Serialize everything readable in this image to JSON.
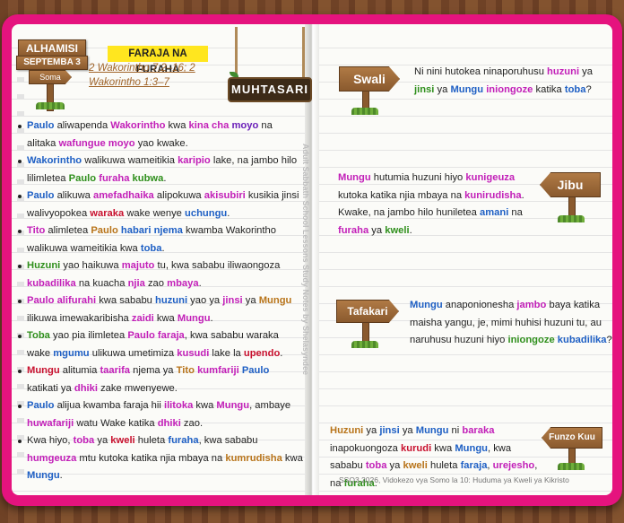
{
  "header": {
    "day": "ALHAMISI",
    "date": "SEPTEMBA 3",
    "soma": "Soma",
    "title": "FARAJA NA FURAHA",
    "ref1": "2 Wakorintho 7:2–16; 2",
    "ref2": "Wakorintho 1:3–7",
    "summary_sign": "MUHTASARI"
  },
  "bullets": [
    [
      [
        "b",
        "Paulo"
      ],
      [
        "n",
        " aliwapenda "
      ],
      [
        "m",
        "Wakorintho"
      ],
      [
        "n",
        " kwa "
      ],
      [
        "m",
        "kina cha"
      ],
      [
        "n",
        " "
      ],
      [
        "p",
        "moyo"
      ],
      [
        "n",
        " na alitaka "
      ],
      [
        "m",
        "wafungue moyo"
      ],
      [
        "n",
        " yao kwake."
      ]
    ],
    [
      [
        "b",
        "Wakorintho"
      ],
      [
        "n",
        " walikuwa wameitikia "
      ],
      [
        "m",
        "karipio"
      ],
      [
        "n",
        " lake, na jambo hilo lilimletea "
      ],
      [
        "g",
        "Paulo"
      ],
      [
        "n",
        " "
      ],
      [
        "m",
        "furaha"
      ],
      [
        "n",
        " "
      ],
      [
        "g",
        "kubwa"
      ],
      [
        "n",
        "."
      ]
    ],
    [
      [
        "b",
        "Paulo"
      ],
      [
        "n",
        " alikuwa "
      ],
      [
        "m",
        "amefadhaika"
      ],
      [
        "n",
        " alipokuwa "
      ],
      [
        "m",
        "akisubiri"
      ],
      [
        "n",
        " kusikia jinsi walivyopokea "
      ],
      [
        "r",
        "waraka"
      ],
      [
        "n",
        " wake wenye "
      ],
      [
        "b",
        "uchungu"
      ],
      [
        "n",
        "."
      ]
    ],
    [
      [
        "m",
        "Tito"
      ],
      [
        "n",
        " alimletea "
      ],
      [
        "o",
        "Paulo"
      ],
      [
        "n",
        " "
      ],
      [
        "b",
        "habari njema"
      ],
      [
        "n",
        " kwamba Wakorintho walikuwa wameitikia kwa "
      ],
      [
        "b",
        "toba"
      ],
      [
        "n",
        "."
      ]
    ],
    [
      [
        "g",
        "Huzuni"
      ],
      [
        "n",
        " yao haikuwa "
      ],
      [
        "m",
        "majuto"
      ],
      [
        "n",
        " tu, kwa sababu iliwaongoza "
      ],
      [
        "m",
        "kubadilika"
      ],
      [
        "n",
        " na kuacha "
      ],
      [
        "m",
        "njia"
      ],
      [
        "n",
        " zao "
      ],
      [
        "m",
        "mbaya"
      ],
      [
        "n",
        "."
      ]
    ],
    [
      [
        "m",
        "Paulo"
      ],
      [
        "n",
        " "
      ],
      [
        "m",
        "alifurahi"
      ],
      [
        "n",
        " kwa sababu "
      ],
      [
        "b",
        "huzuni"
      ],
      [
        "n",
        " yao ya "
      ],
      [
        "m",
        "jinsi"
      ],
      [
        "n",
        " ya "
      ],
      [
        "o",
        "Mungu"
      ],
      [
        "n",
        " ilikuwa imewakaribisha "
      ],
      [
        "m",
        "zaidi"
      ],
      [
        "n",
        " kwa "
      ],
      [
        "m",
        "Mungu"
      ],
      [
        "n",
        "."
      ]
    ],
    [
      [
        "g",
        "Toba"
      ],
      [
        "n",
        " yao pia ilimletea "
      ],
      [
        "m",
        "Paulo"
      ],
      [
        "n",
        " "
      ],
      [
        "m",
        "faraja"
      ],
      [
        "n",
        ", kwa sababu waraka wake "
      ],
      [
        "b",
        "mgumu"
      ],
      [
        "n",
        " ulikuwa umetimiza "
      ],
      [
        "m",
        "kusudi"
      ],
      [
        "n",
        " lake la "
      ],
      [
        "r",
        "upendo"
      ],
      [
        "n",
        "."
      ]
    ],
    [
      [
        "r",
        "Mungu"
      ],
      [
        "n",
        " alitumia "
      ],
      [
        "m",
        "taarifa"
      ],
      [
        "n",
        " njema ya "
      ],
      [
        "o",
        "Tito"
      ],
      [
        "n",
        " "
      ],
      [
        "m",
        "kumfariji"
      ],
      [
        "n",
        " "
      ],
      [
        "b",
        "Paulo"
      ],
      [
        "n",
        " katikati ya "
      ],
      [
        "m",
        "dhiki"
      ],
      [
        "n",
        " zake mwenyewe."
      ]
    ],
    [
      [
        "b",
        "Paulo"
      ],
      [
        "n",
        " alijua kwamba faraja hii "
      ],
      [
        "m",
        "ilitoka"
      ],
      [
        "n",
        " kwa "
      ],
      [
        "m",
        "Mungu"
      ],
      [
        "n",
        ", ambaye "
      ],
      [
        "m",
        "huwafariji"
      ],
      [
        "n",
        " watu Wake katika "
      ],
      [
        "m",
        "dhiki"
      ],
      [
        "n",
        " zao."
      ]
    ],
    [
      [
        "n",
        "Kwa hiyo, "
      ],
      [
        "m",
        "toba"
      ],
      [
        "n",
        " ya "
      ],
      [
        "r",
        "kweli"
      ],
      [
        "n",
        " huleta "
      ],
      [
        "b",
        "furaha"
      ],
      [
        "n",
        ", kwa sababu "
      ],
      [
        "m",
        "humgeuza"
      ],
      [
        "n",
        " mtu kutoka katika njia mbaya na "
      ],
      [
        "o",
        "kumrudisha"
      ],
      [
        "n",
        " kwa "
      ],
      [
        "b",
        "Mungu"
      ],
      [
        "n",
        "."
      ]
    ]
  ],
  "side_text": "Adult Sabbath School Lessons Study Notes by Shelasyndee",
  "signs": {
    "swali": "Swali",
    "jibu": "Jibu",
    "tafakari": "Tafakari",
    "funzo": "Funzo Kuu"
  },
  "right": {
    "swali": [
      [
        "n",
        "Ni nini hutokea ninaporuhusu "
      ],
      [
        "m",
        "huzuni"
      ],
      [
        "n",
        " ya "
      ],
      [
        "g",
        "jinsi"
      ],
      [
        "n",
        " ya "
      ],
      [
        "b",
        "Mungu"
      ],
      [
        "n",
        " "
      ],
      [
        "m",
        "iniongoze"
      ],
      [
        "n",
        " katika "
      ],
      [
        "b",
        "toba"
      ],
      [
        "n",
        "?"
      ]
    ],
    "jibu": [
      [
        "m",
        "Mungu"
      ],
      [
        "n",
        " hutumia huzuni hiyo "
      ],
      [
        "m",
        "kunigeuza"
      ],
      [
        "n",
        " kutoka katika njia mbaya na "
      ],
      [
        "m",
        "kunirudisha"
      ],
      [
        "n",
        ". Kwake, na jambo hilo huniletea "
      ],
      [
        "b",
        "amani"
      ],
      [
        "n",
        " na "
      ],
      [
        "m",
        "furaha"
      ],
      [
        "n",
        " ya "
      ],
      [
        "g",
        "kweli"
      ],
      [
        "n",
        "."
      ]
    ],
    "tafakari": [
      [
        "b",
        "Mungu"
      ],
      [
        "n",
        " anaponionesha "
      ],
      [
        "m",
        "jambo"
      ],
      [
        "n",
        " baya katika maisha yangu, je, mimi huhisi huzuni tu, au naruhusu huzuni hiyo "
      ],
      [
        "g",
        "iniongoze"
      ],
      [
        "n",
        " "
      ],
      [
        "b",
        "kubadilika"
      ],
      [
        "n",
        "?"
      ]
    ],
    "funzo": [
      [
        "o",
        "Huzuni"
      ],
      [
        "n",
        " ya "
      ],
      [
        "b",
        "jinsi"
      ],
      [
        "n",
        " ya "
      ],
      [
        "b",
        "Mungu"
      ],
      [
        "n",
        " ni "
      ],
      [
        "m",
        "baraka"
      ],
      [
        "n",
        " inapokuongoza "
      ],
      [
        "r",
        "kurudi"
      ],
      [
        "n",
        " kwa "
      ],
      [
        "b",
        "Mungu"
      ],
      [
        "n",
        ", kwa sababu "
      ],
      [
        "m",
        "toba"
      ],
      [
        "n",
        " ya "
      ],
      [
        "o",
        "kweli"
      ],
      [
        "n",
        " huleta "
      ],
      [
        "b",
        "faraja"
      ],
      [
        "n",
        ", "
      ],
      [
        "m",
        "urejesho"
      ],
      [
        "n",
        ", na "
      ],
      [
        "g",
        "furaha"
      ],
      [
        "n",
        "."
      ]
    ]
  },
  "footer": "SSQ3 2026, Vidokezo vya Somo la 10: Huduma ya Kweli ya Kikristo",
  "colors": {
    "cover": "#e5137e",
    "blue": "#1e5fc4",
    "magenta": "#c21fb8",
    "red": "#c8102e",
    "orange": "#b8741a",
    "green": "#2f8f1c"
  }
}
